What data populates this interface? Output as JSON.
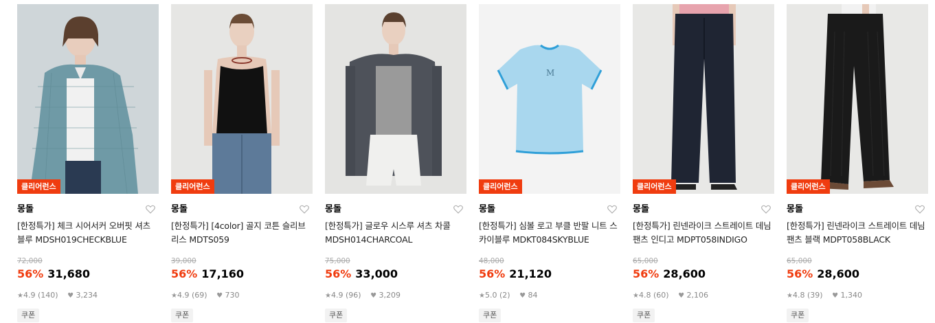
{
  "products": [
    {
      "badge": "클리어런스",
      "brand": "몽돌",
      "title": "[한정특가] 체크 시어서커 오버핏 셔츠 블루 MDSH019CHECKBLUE",
      "original_price": "72,000",
      "discount": "56%",
      "price": "31,680",
      "rating": "4.9",
      "reviews": "(140)",
      "likes": "3,234",
      "coupon": "쿠폰",
      "bg_color": "#d7dde0",
      "garment_color": "#6f9aa6"
    },
    {
      "badge": "클리어런스",
      "brand": "몽돌",
      "title": "[한정특가] [4color] 골지 코튼 슬리브리스 MDTS059",
      "original_price": "39,000",
      "discount": "56%",
      "price": "17,160",
      "rating": "4.9",
      "reviews": "(69)",
      "likes": "730",
      "coupon": "쿠폰",
      "bg_color": "#e6e6e4",
      "garment_color": "#111111"
    },
    {
      "badge": "",
      "brand": "몽돌",
      "title": "[한정특가] 글로우 시스루 셔츠 차콜 MDSH014CHARCOAL",
      "original_price": "75,000",
      "discount": "56%",
      "price": "33,000",
      "rating": "4.9",
      "reviews": "(96)",
      "likes": "3,209",
      "coupon": "쿠폰",
      "bg_color": "#e4e4e2",
      "garment_color": "#4e525a"
    },
    {
      "badge": "클리어런스",
      "brand": "몽돌",
      "title": "[한정특가] 심볼 로고 부클 반팔 니트 스카이블루 MDKT084SKYBLUE",
      "original_price": "48,000",
      "discount": "56%",
      "price": "21,120",
      "rating": "5.0",
      "reviews": "(2)",
      "likes": "84",
      "coupon": "쿠폰",
      "bg_color": "#f3f3f3",
      "garment_color": "#a9d7ee"
    },
    {
      "badge": "클리어런스",
      "brand": "몽돌",
      "title": "[한정특가] 린넨라이크 스트레이트 데님 팬츠 인디고 MDPT058INDIGO",
      "original_price": "65,000",
      "discount": "56%",
      "price": "28,600",
      "rating": "4.8",
      "reviews": "(60)",
      "likes": "2,106",
      "coupon": "쿠폰",
      "bg_color": "#e8e8e6",
      "garment_color": "#1f2533"
    },
    {
      "badge": "클리어런스",
      "brand": "몽돌",
      "title": "[한정특가] 린넨라이크 스트레이트 데님 팬츠 블랙 MDPT058BLACK",
      "original_price": "65,000",
      "discount": "56%",
      "price": "28,600",
      "rating": "4.8",
      "reviews": "(39)",
      "likes": "1,340",
      "coupon": "쿠폰",
      "bg_color": "#e8e8e6",
      "garment_color": "#1a1a1a"
    }
  ],
  "icons": {
    "heart": "heart-outline-icon",
    "star": "star-icon",
    "like": "heart-filled-icon"
  },
  "colors": {
    "accent": "#f03c0f",
    "price": "#000000",
    "muted": "#888888"
  }
}
